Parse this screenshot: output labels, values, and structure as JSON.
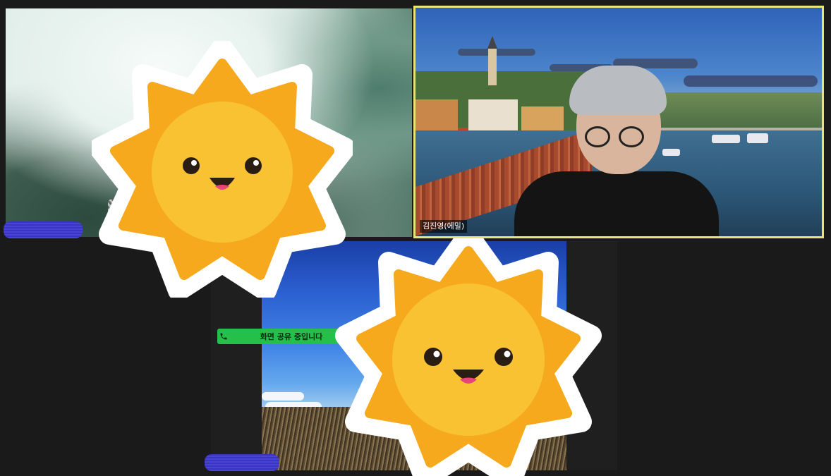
{
  "participants": [
    {
      "id": "tile-a",
      "name": "",
      "name_redacted": true
    },
    {
      "id": "tile-b",
      "name": "김진영(에밀)",
      "active_speaker": true
    },
    {
      "id": "tile-c",
      "name": "",
      "name_redacted": true,
      "sharing": true
    }
  ],
  "share_banner": {
    "label": "화면 공유 중입니다",
    "icons": [
      "phone-icon",
      "shield-check-icon",
      "stop-share-icon"
    ]
  },
  "overlays": [
    "sun-sticker",
    "sun-sticker"
  ],
  "colors": {
    "background": "#1a1a1a",
    "active_speaker_border": "#e6e67a",
    "share_banner": "#24c04a",
    "stop_share": "#e23838",
    "redaction": "#4a44d6",
    "sun_outer": "#f6a91c",
    "sun_inner": "#f8c232"
  }
}
